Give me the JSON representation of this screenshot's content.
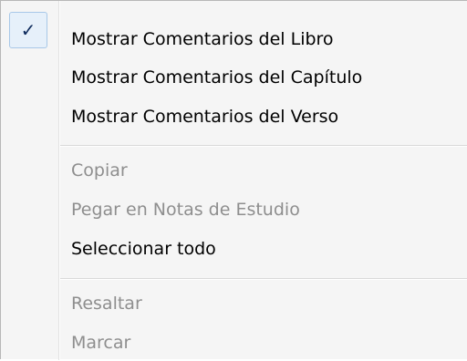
{
  "menu": {
    "items": [
      {
        "label": "Mostrar Comentarios del Libro",
        "checked": true,
        "enabled": true
      },
      {
        "label": "Mostrar Comentarios del Capítulo",
        "checked": false,
        "enabled": true
      },
      {
        "label": "Mostrar Comentarios del Verso",
        "checked": false,
        "enabled": true
      },
      {
        "label": "Copiar",
        "checked": false,
        "enabled": false
      },
      {
        "label": "Pegar en Notas de Estudio",
        "checked": false,
        "enabled": false
      },
      {
        "label": "Seleccionar todo",
        "checked": false,
        "enabled": true
      },
      {
        "label": "Resaltar",
        "checked": false,
        "enabled": false
      },
      {
        "label": "Marcar",
        "checked": false,
        "enabled": false
      }
    ],
    "check_glyph": "✓",
    "check_icon": "checkmark-icon",
    "colors": {
      "menu_background": "#f5f5f5",
      "text_enabled": "#000000",
      "text_disabled": "#8e8e8e",
      "check_highlight": "#e6f0fa",
      "check_border": "#a8c8e8",
      "check_color": "#0d2a5c"
    }
  }
}
